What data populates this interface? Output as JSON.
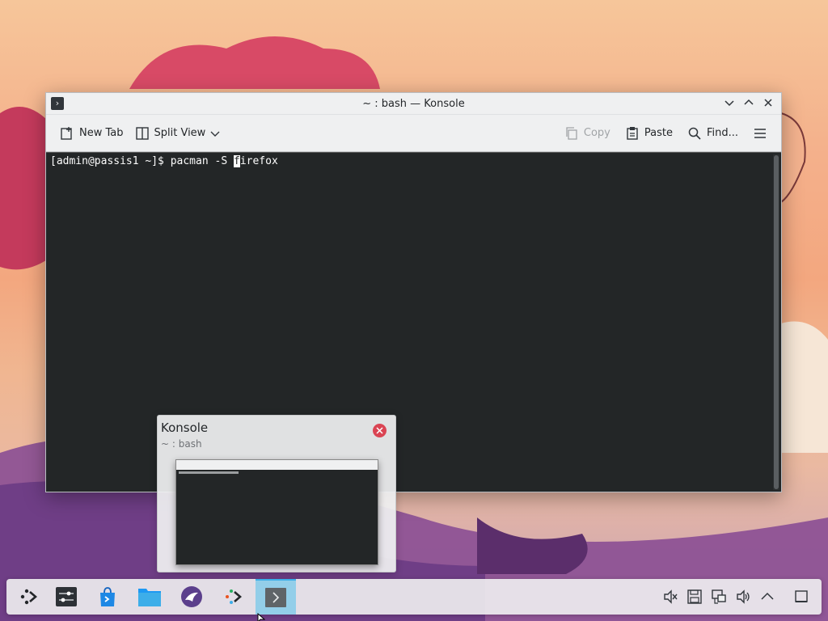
{
  "window": {
    "title": "~ : bash — Konsole",
    "minimize_glyph": "⌄",
    "maximize_glyph": "⌃",
    "close_glyph": "✕"
  },
  "toolbar": {
    "new_tab": "New Tab",
    "split_view": "Split View",
    "copy": "Copy",
    "paste": "Paste",
    "find": "Find..."
  },
  "terminal": {
    "prompt": "[admin@passis1 ~]$ pacman -S ",
    "cursor_char": "f",
    "after_cursor": "irefox"
  },
  "tooltip": {
    "title": "Konsole",
    "subtitle": "~ : bash"
  },
  "taskbar": {
    "items": [
      "application-launcher-icon",
      "system-settings-icon",
      "discover-store-icon",
      "dolphin-folder-icon",
      "krita-icon",
      "kde-connect-icon",
      "konsole-icon"
    ],
    "tray": [
      "audio-muted-icon",
      "disk-save-icon",
      "network-wired-icon",
      "volume-icon",
      "tray-expand-icon",
      "show-desktop-icon"
    ]
  },
  "colors": {
    "terminal_bg": "#232627",
    "accent": "#3daee9",
    "close_red": "#da4453"
  }
}
